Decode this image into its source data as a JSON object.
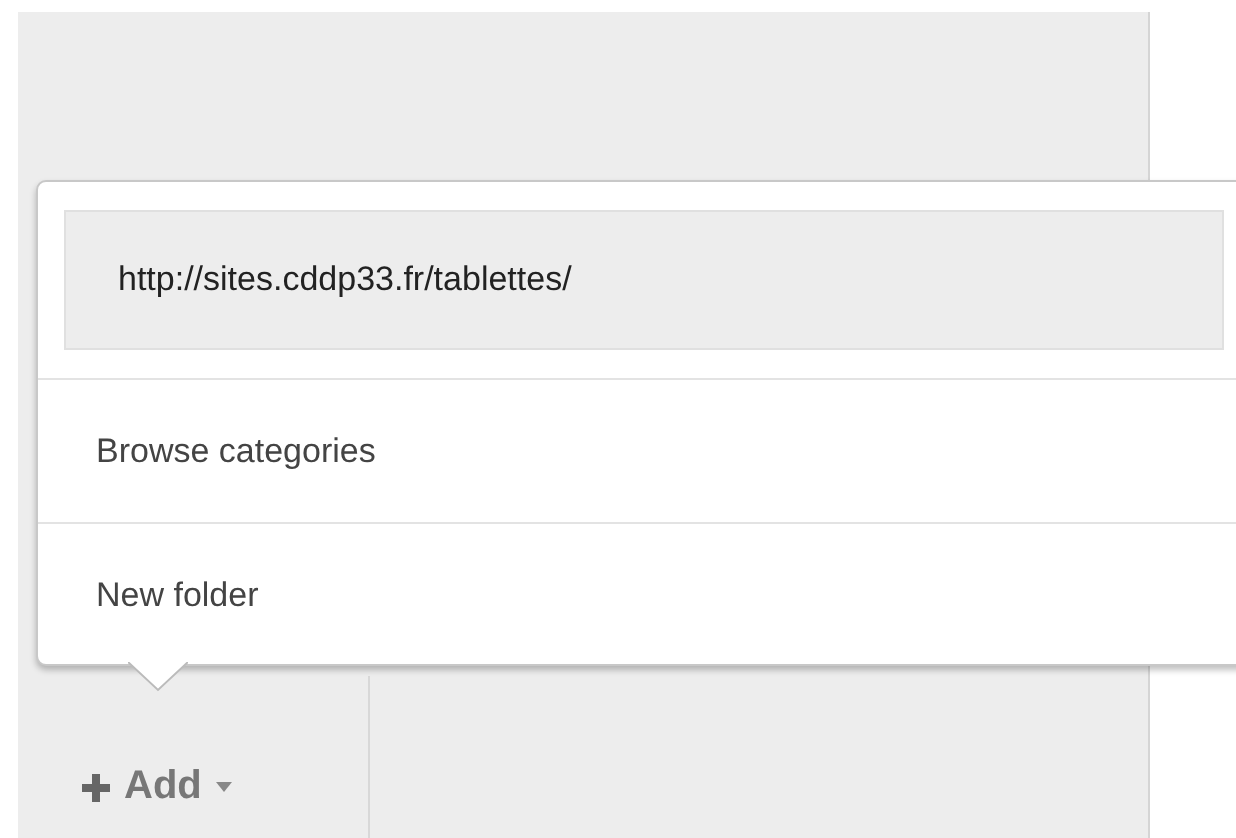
{
  "url_field": {
    "value": "http://sites.cddp33.fr/tablettes/"
  },
  "menu_items": [
    {
      "label": "Browse categories"
    },
    {
      "label": "New folder"
    }
  ],
  "add_button": {
    "label": "Add"
  }
}
